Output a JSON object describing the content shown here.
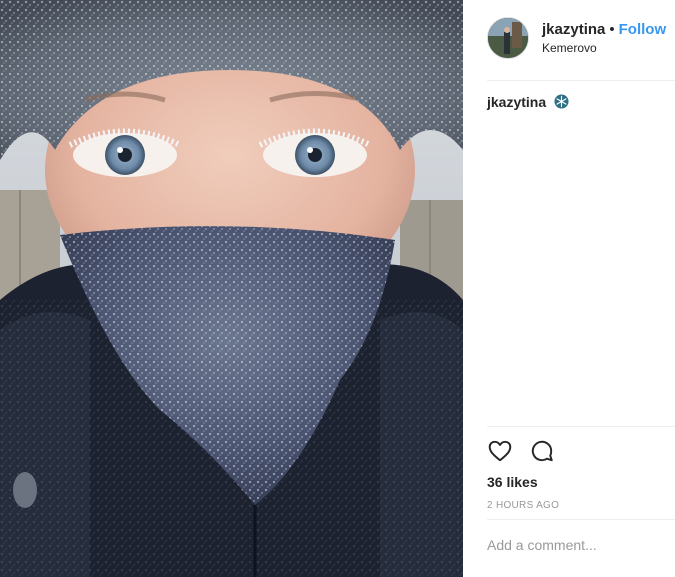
{
  "post": {
    "username": "jkazytina",
    "separator": "•",
    "follow_label": "Follow",
    "location": "Kemerovo",
    "caption_username": "jkazytina",
    "caption_extra": "⁡⁢⁣",
    "likes": "36 likes",
    "timestamp": "2 HOURS AGO",
    "comment_placeholder": "Add a comment..."
  },
  "colors": {
    "follow": "#3897f0",
    "text": "#262626",
    "muted": "#999999",
    "divider": "#efefef"
  },
  "icons": {
    "like": "heart-icon",
    "comment": "comment-bubble-icon",
    "caption_emoji": "snowflake-icon"
  }
}
